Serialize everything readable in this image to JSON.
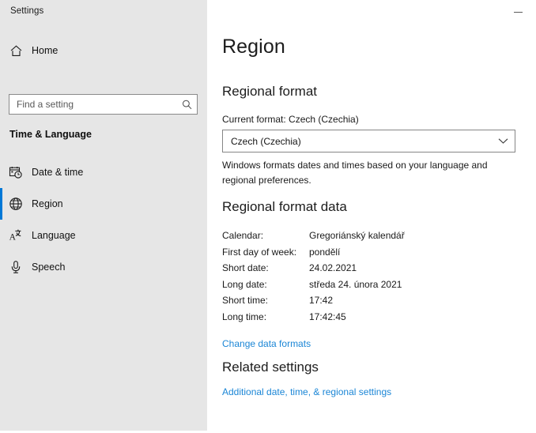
{
  "window": {
    "title": "Settings",
    "minimize_label": "Minimize",
    "minimize_icon": "minimize-icon"
  },
  "sidebar": {
    "home": {
      "label": "Home",
      "icon": "home-icon"
    },
    "search": {
      "value": "",
      "placeholder": "Find a setting",
      "icon": "search-icon"
    },
    "group_header": "Time & Language",
    "items": [
      {
        "label": "Date & time",
        "icon": "calendar-clock-icon",
        "selected": false
      },
      {
        "label": "Region",
        "icon": "globe-icon",
        "selected": true
      },
      {
        "label": "Language",
        "icon": "translate-icon",
        "selected": false
      },
      {
        "label": "Speech",
        "icon": "microphone-icon",
        "selected": false
      }
    ],
    "accent_color": "#0078d7",
    "background_color": "#e6e6e6"
  },
  "main": {
    "page_title": "Region",
    "regional_format": {
      "section_title": "Regional format",
      "current_format_text": "Current format: Czech (Czechia)",
      "dropdown_value": "Czech (Czechia)",
      "dropdown_icon": "chevron-down-icon",
      "description": "Windows formats dates and times based on your language and regional preferences."
    },
    "regional_format_data": {
      "section_title": "Regional format data",
      "rows": [
        {
          "key": "Calendar:",
          "value": "Gregoriánský kalendář"
        },
        {
          "key": "First day of week:",
          "value": "pondělí"
        },
        {
          "key": "Short date:",
          "value": "24.02.2021"
        },
        {
          "key": "Long date:",
          "value": "středa 24. února 2021"
        },
        {
          "key": "Short time:",
          "value": "17:42"
        },
        {
          "key": "Long time:",
          "value": "17:42:45"
        }
      ],
      "change_link": "Change data formats"
    },
    "related_settings": {
      "section_title": "Related settings",
      "links": [
        {
          "label": "Additional date, time, & regional settings"
        }
      ]
    },
    "link_color": "#1b86d6"
  }
}
